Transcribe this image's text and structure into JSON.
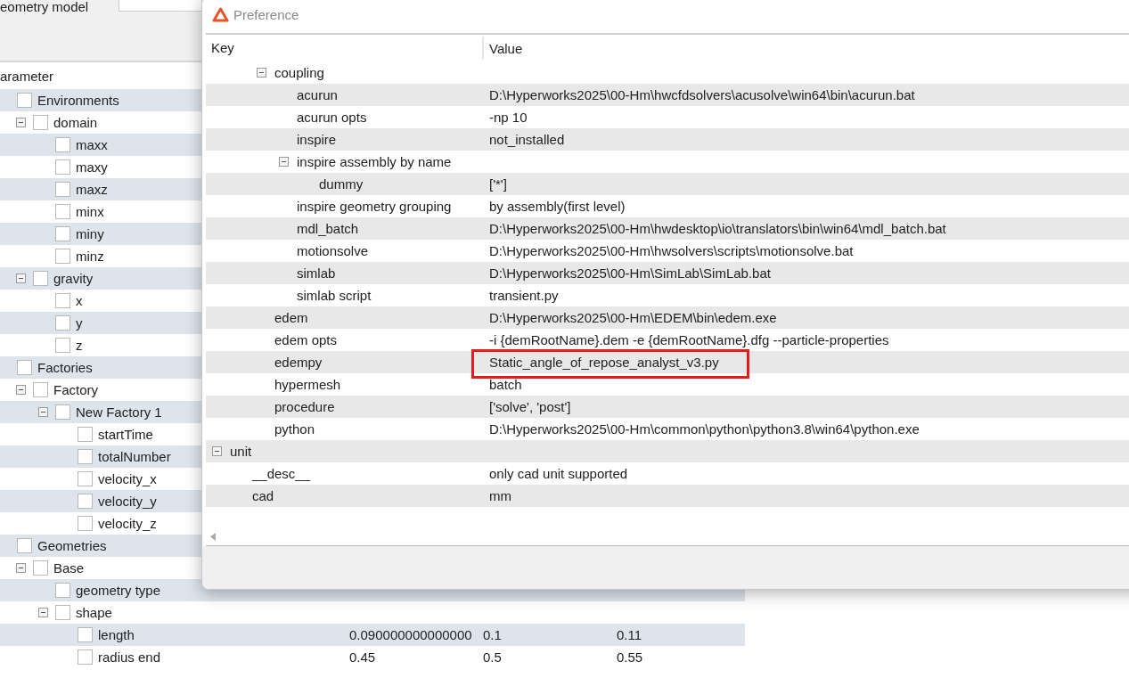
{
  "background_window": {
    "tab": {
      "label": "eometry model"
    },
    "parameter_table": {
      "header": "arameter",
      "rows": [
        {
          "label": "Environments",
          "checked": false,
          "children": [
            {
              "label": "domain",
              "checked": false,
              "expanded": true,
              "children": [
                {
                  "label": "maxx",
                  "checked": false
                },
                {
                  "label": "maxy",
                  "checked": false
                },
                {
                  "label": "maxz",
                  "checked": false
                },
                {
                  "label": "minx",
                  "checked": false
                },
                {
                  "label": "miny",
                  "checked": false
                },
                {
                  "label": "minz",
                  "checked": false
                }
              ]
            },
            {
              "label": "gravity",
              "checked": false,
              "expanded": true,
              "children": [
                {
                  "label": "x",
                  "checked": false
                },
                {
                  "label": "y",
                  "checked": false
                },
                {
                  "label": "z",
                  "checked": false
                }
              ]
            }
          ]
        },
        {
          "label": "Factories",
          "checked": false,
          "children": [
            {
              "label": "Factory",
              "checked": false,
              "expanded": true,
              "children": [
                {
                  "label": "New Factory 1",
                  "checked": false,
                  "expanded": true,
                  "children": [
                    {
                      "label": "startTime",
                      "checked": false
                    },
                    {
                      "label": "totalNumber",
                      "checked": false
                    },
                    {
                      "label": "velocity_x",
                      "checked": false
                    },
                    {
                      "label": "velocity_y",
                      "checked": false
                    },
                    {
                      "label": "velocity_z",
                      "checked": false
                    }
                  ]
                }
              ]
            }
          ]
        },
        {
          "label": "Geometries",
          "checked": false,
          "children": [
            {
              "label": "Base",
              "checked": false,
              "expanded": true,
              "children": [
                {
                  "label": "geometry type",
                  "checked": false
                },
                {
                  "label": "shape",
                  "checked": false,
                  "expanded": true,
                  "children": [
                    {
                      "label": "length",
                      "checked": false,
                      "values": [
                        "0.090000000000000",
                        "0.1",
                        "0.11"
                      ]
                    },
                    {
                      "label": "radius end",
                      "checked": false,
                      "values": [
                        "0.45",
                        "0.5",
                        "0.55"
                      ]
                    }
                  ]
                }
              ]
            }
          ]
        }
      ]
    }
  },
  "dialog": {
    "title": "Preference",
    "columns": [
      "Key",
      "Value"
    ],
    "rows": [
      {
        "children": [
          {
            "children": [
              {
                "key": "coupling",
                "expanded": true,
                "children": [
                  {
                    "key": "acurun",
                    "value": "D:\\Hyperworks2025\\00-Hm\\hwcfdsolvers\\acusolve\\win64\\bin\\acurun.bat"
                  },
                  {
                    "key": "acurun opts",
                    "value": "-np 10"
                  },
                  {
                    "key": "inspire",
                    "value": "not_installed"
                  },
                  {
                    "key": "inspire assembly by name",
                    "expanded": true,
                    "children": [
                      {
                        "key": "dummy",
                        "value": "['*']"
                      }
                    ]
                  },
                  {
                    "key": "inspire geometry grouping",
                    "value": "by assembly(first level)"
                  },
                  {
                    "key": "mdl_batch",
                    "value": "D:\\Hyperworks2025\\00-Hm\\hwdesktop\\io\\translators\\bin\\win64\\mdl_batch.bat"
                  },
                  {
                    "key": "motionsolve",
                    "value": "D:\\Hyperworks2025\\00-Hm\\hwsolvers\\scripts\\motionsolve.bat"
                  },
                  {
                    "key": "simlab",
                    "value": "D:\\Hyperworks2025\\00-Hm\\SimLab\\SimLab.bat"
                  },
                  {
                    "key": "simlab script",
                    "value": "transient.py"
                  }
                ]
              },
              {
                "key": "edem",
                "value": "D:\\Hyperworks2025\\00-Hm\\EDEM\\bin\\edem.exe"
              },
              {
                "key": "edem opts",
                "value": "-i {demRootName}.dem -e {demRootName}.dfg --particle-properties"
              },
              {
                "key": "edempy",
                "value": "Static_angle_of_repose_analyst_v3.py",
                "highlighted": true
              },
              {
                "key": "hypermesh",
                "value": "batch"
              },
              {
                "key": "procedure",
                "value": "['solve', 'post']"
              },
              {
                "key": "python",
                "value": "D:\\Hyperworks2025\\00-Hm\\common\\python\\python3.8\\win64\\python.exe"
              }
            ]
          }
        ]
      },
      {
        "key": "unit",
        "expanded": true,
        "children": [
          {
            "key": "__desc__",
            "value": "only cad unit supported"
          },
          {
            "key": "cad",
            "value": "mm"
          }
        ]
      }
    ]
  }
}
